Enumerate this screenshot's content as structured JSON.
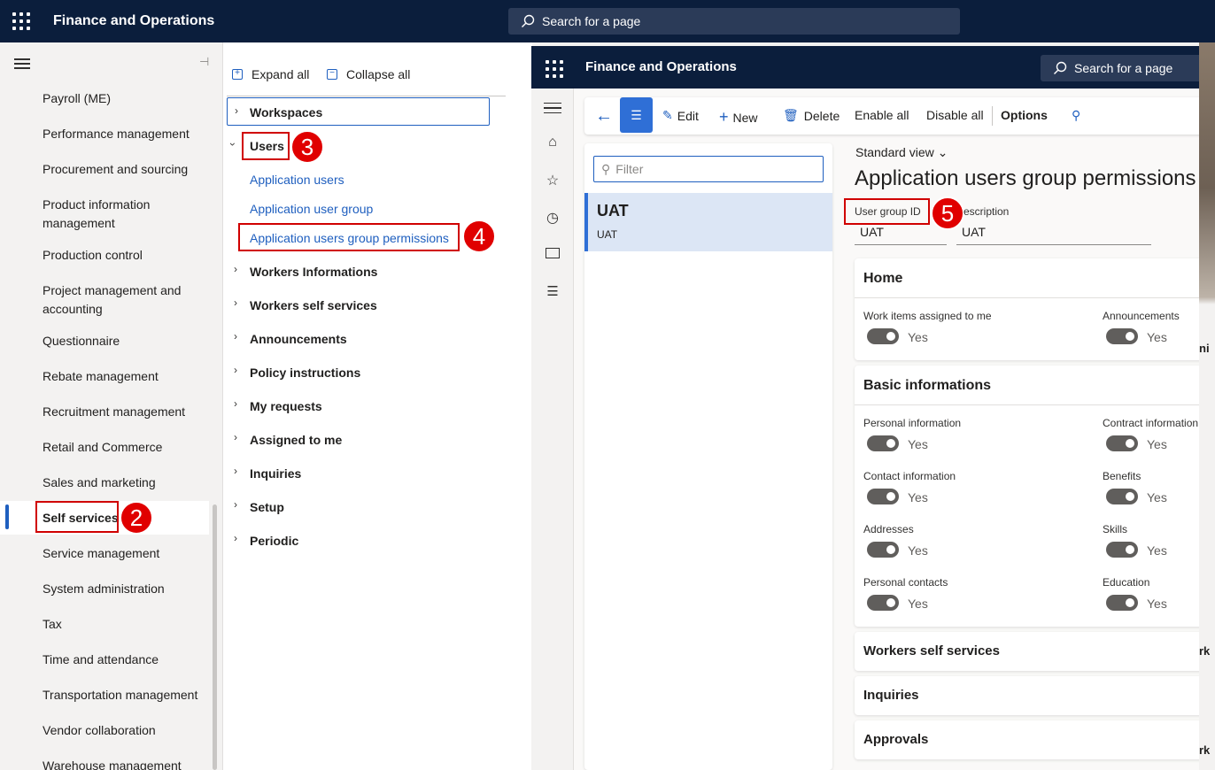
{
  "app": {
    "title": "Finance and Operations",
    "search_placeholder": "Search for a page"
  },
  "nav": {
    "items": [
      {
        "label": "Payroll (ME)"
      },
      {
        "label": "Performance management"
      },
      {
        "label": "Procurement and sourcing"
      },
      {
        "label": "Product information management"
      },
      {
        "label": "Production control"
      },
      {
        "label": "Project management and accounting"
      },
      {
        "label": "Questionnaire"
      },
      {
        "label": "Rebate management"
      },
      {
        "label": "Recruitment management"
      },
      {
        "label": "Retail and Commerce"
      },
      {
        "label": "Sales and marketing"
      },
      {
        "label": "Self services"
      },
      {
        "label": "Service management"
      },
      {
        "label": "System administration"
      },
      {
        "label": "Tax"
      },
      {
        "label": "Time and attendance"
      },
      {
        "label": "Transportation management"
      },
      {
        "label": "Vendor collaboration"
      },
      {
        "label": "Warehouse management"
      }
    ]
  },
  "menu": {
    "expand_all": "Expand all",
    "collapse_all": "Collapse all",
    "workspaces": "Workspaces",
    "users": "Users",
    "users_children": [
      "Application users",
      "Application user group",
      "Application users group permissions"
    ],
    "groups": [
      "Workers Informations",
      "Workers self services",
      "Announcements",
      "Policy instructions",
      "My requests",
      "Assigned to me",
      "Inquiries",
      "Setup",
      "Periodic"
    ]
  },
  "steps": {
    "s2": "2",
    "s3": "3",
    "s4": "4",
    "s5": "5"
  },
  "inner": {
    "title": "Finance and Operations",
    "search_placeholder": "Search for a page",
    "toolbar": {
      "edit": "Edit",
      "new": "New",
      "delete": "Delete",
      "enable_all": "Enable all",
      "disable_all": "Disable all",
      "options": "Options"
    },
    "filter_placeholder": "Filter",
    "list": [
      {
        "title": "UAT",
        "subtitle": "UAT"
      }
    ],
    "view": "Standard view",
    "page_title": "Application users group permissions",
    "fields": {
      "id_label": "User group ID",
      "desc_label": "escription",
      "id_value": "UAT",
      "desc_value": "UAT"
    },
    "sections": {
      "home": {
        "title": "Home",
        "items": [
          {
            "label": "Work items assigned to me",
            "value": "Yes"
          },
          {
            "label": "Announcements",
            "value": "Yes"
          }
        ]
      },
      "basic": {
        "title": "Basic informations",
        "items": [
          {
            "label": "Personal information",
            "value": "Yes"
          },
          {
            "label": "Contract information",
            "value": "Yes"
          },
          {
            "label": "Contact information",
            "value": "Yes"
          },
          {
            "label": "Benefits",
            "value": "Yes"
          },
          {
            "label": "Addresses",
            "value": "Yes"
          },
          {
            "label": "Skills",
            "value": "Yes"
          },
          {
            "label": "Personal contacts",
            "value": "Yes"
          },
          {
            "label": "Education",
            "value": "Yes"
          }
        ]
      },
      "wss": {
        "title": "Workers self services"
      },
      "inq": {
        "title": "Inquiries"
      },
      "appr": {
        "title": "Approvals"
      }
    },
    "edge_text": [
      "ni",
      "rk",
      "rk"
    ]
  }
}
